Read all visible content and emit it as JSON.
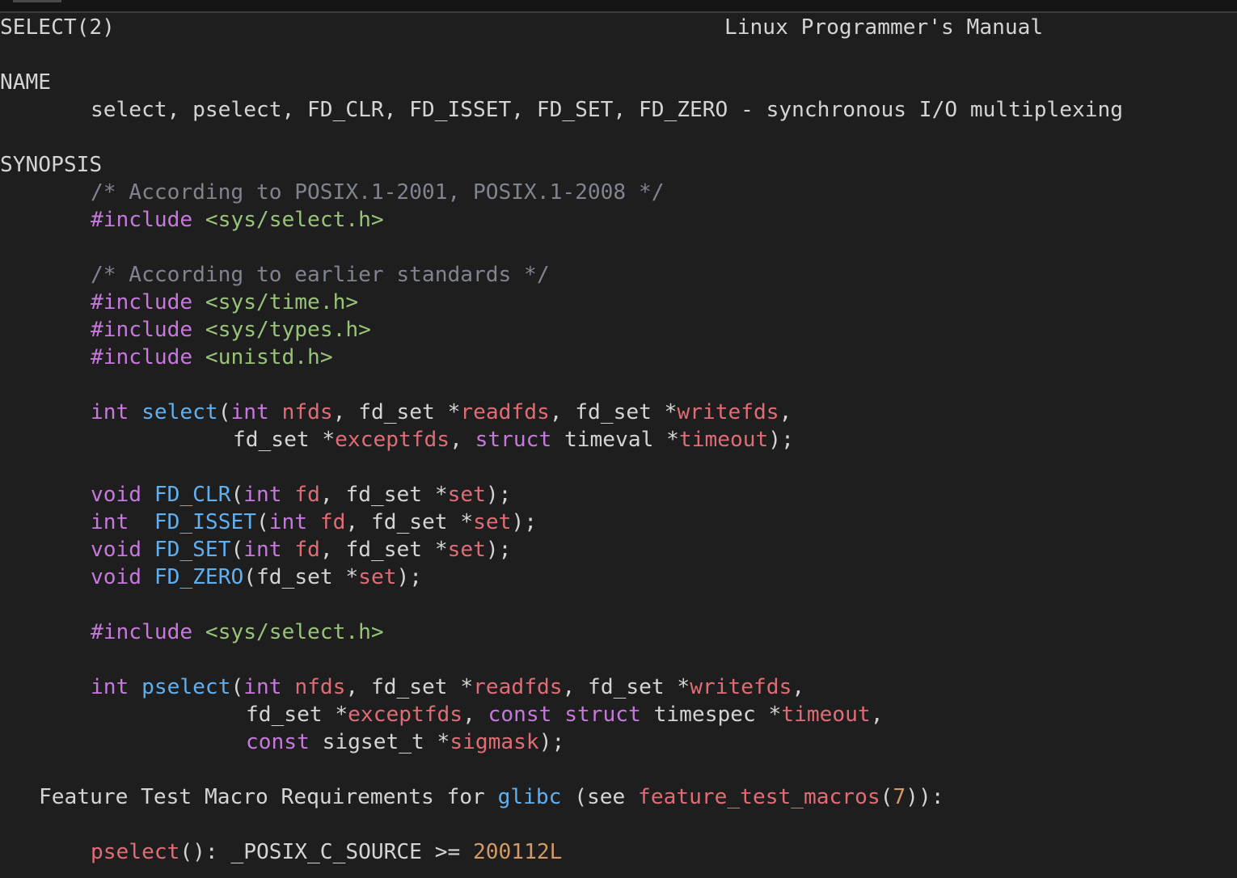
{
  "header": {
    "left": "SELECT(2)",
    "right": "Linux Programmer's Manual"
  },
  "sections": {
    "name_heading": "NAME",
    "name_text": "select, pselect, FD_CLR, FD_ISSET, FD_SET, FD_ZERO - synchronous I/O multiplexing",
    "synopsis_heading": "SYNOPSIS"
  },
  "code": {
    "comment1": "/* According to POSIX.1-2001, POSIX.1-2008 */",
    "include_kw": "#include",
    "inc_select": "<sys/select.h>",
    "comment2": "/* According to earlier standards */",
    "inc_time": "<sys/time.h>",
    "inc_types": "<sys/types.h>",
    "inc_unistd": "<unistd.h>",
    "t_int": "int",
    "t_void": "void",
    "t_struct": "struct",
    "t_const": "const",
    "fn_select": "select",
    "fn_pselect": "pselect",
    "fn_fd_clr": "FD_CLR",
    "fn_fd_isset": "FD_ISSET",
    "fn_fd_set": "FD_SET",
    "fn_fd_zero": "FD_ZERO",
    "p_nfds": "nfds",
    "p_readfds": "readfds",
    "p_writefds": "writefds",
    "p_exceptfds": "exceptfds",
    "p_timeout": "timeout",
    "p_fd": "fd",
    "p_set": "set",
    "p_sigmask": "sigmask",
    "ty_fd_set": "fd_set",
    "ty_timeval": "timeval",
    "ty_timespec": "timespec",
    "ty_sigset_t": "sigset_t"
  },
  "feature": {
    "prefix": "Feature Test Macro Requirements for ",
    "glibc": "glibc",
    "see": " (see ",
    "link": "feature_test_macros",
    "num": "7",
    "suffix": "):",
    "pselect_fn": "pselect",
    "pselect_rest": "(): _POSIX_C_SOURCE >= ",
    "macro_value": "200112L"
  }
}
